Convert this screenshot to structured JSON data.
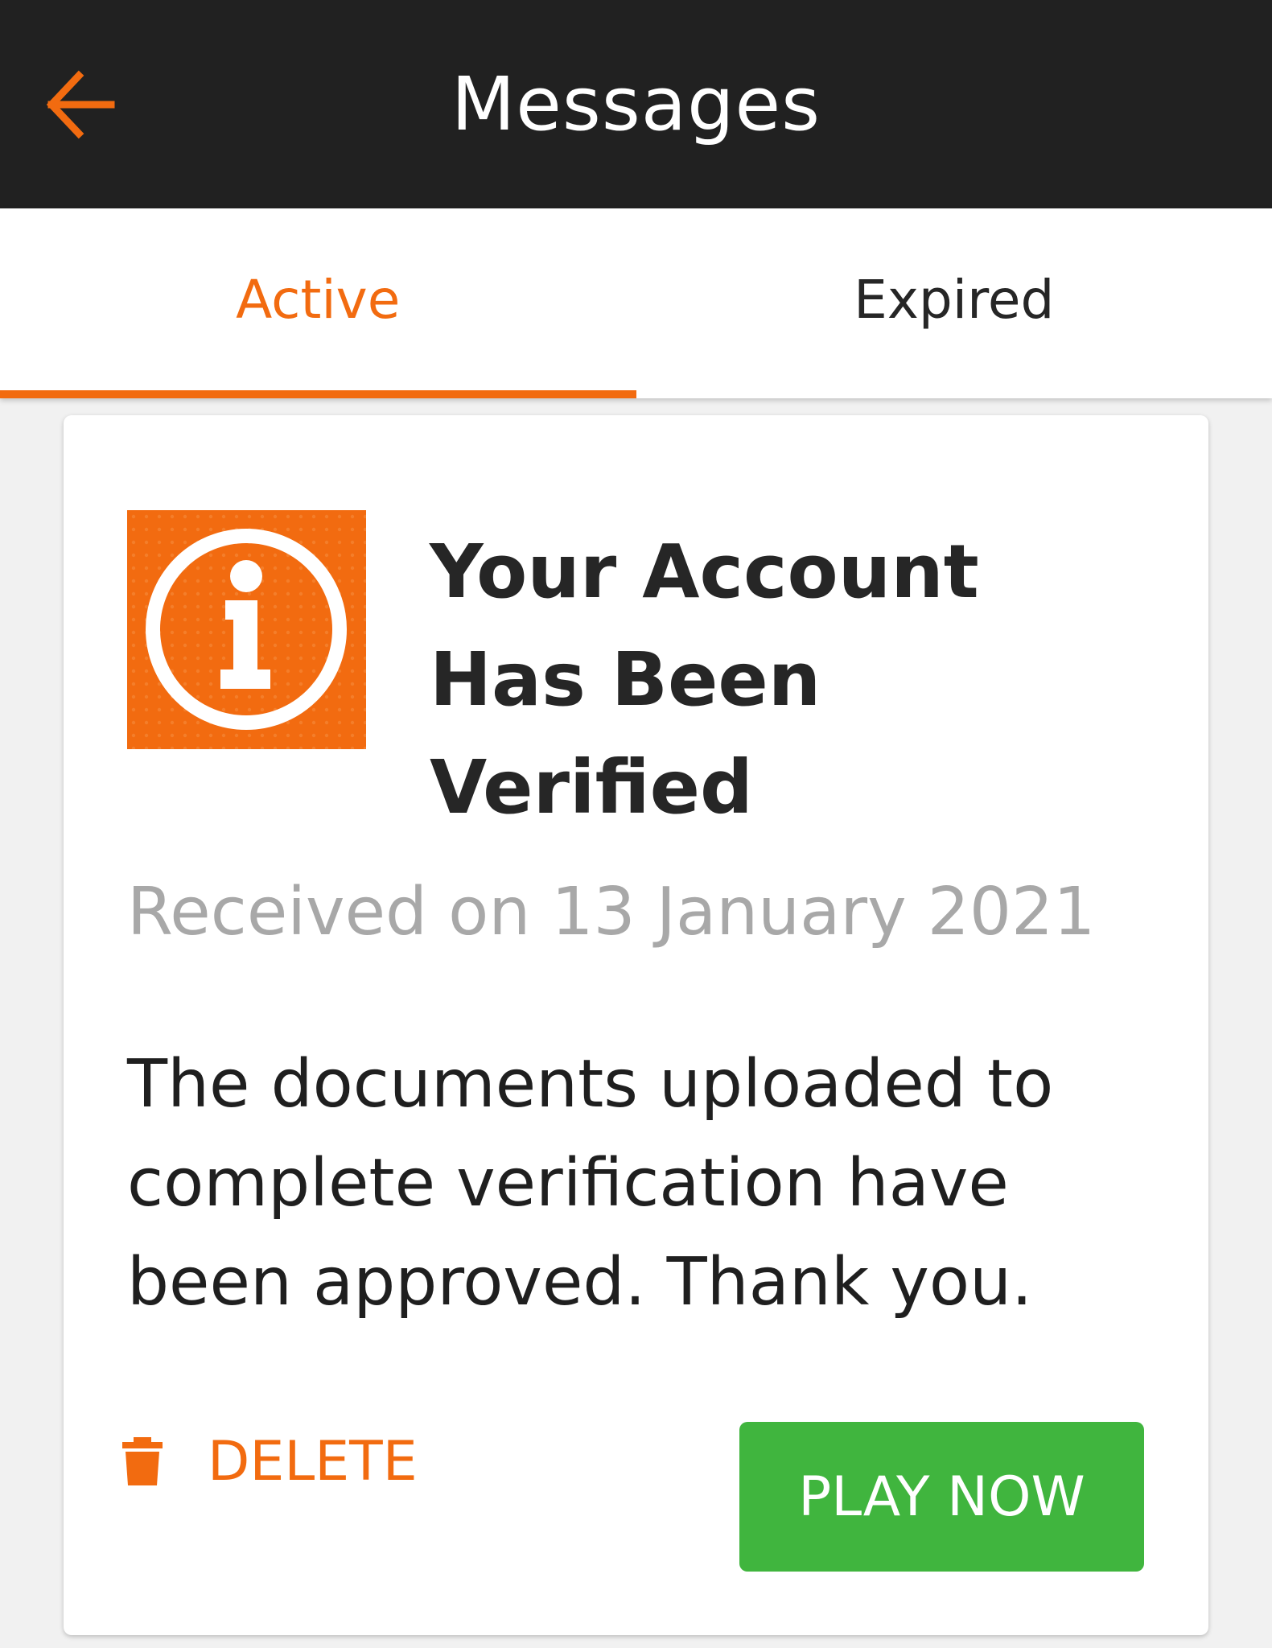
{
  "header": {
    "title": "Messages",
    "back_icon": "arrow-left-icon"
  },
  "tabs": [
    {
      "label": "Active",
      "selected": true
    },
    {
      "label": "Expired",
      "selected": false
    }
  ],
  "message": {
    "icon": "info-icon",
    "title": "Your Account Has Been Verified",
    "received": "Received on 13 January 2021",
    "body": "The documents uploaded to complete verification have been approved. Thank you.",
    "delete_label": "DELETE",
    "delete_icon": "trash-icon",
    "play_label": "PLAY NOW"
  },
  "colors": {
    "accent": "#f26b10",
    "header_bg": "#212121",
    "play_button": "#40b53e",
    "muted_text": "#a8a8a8"
  }
}
